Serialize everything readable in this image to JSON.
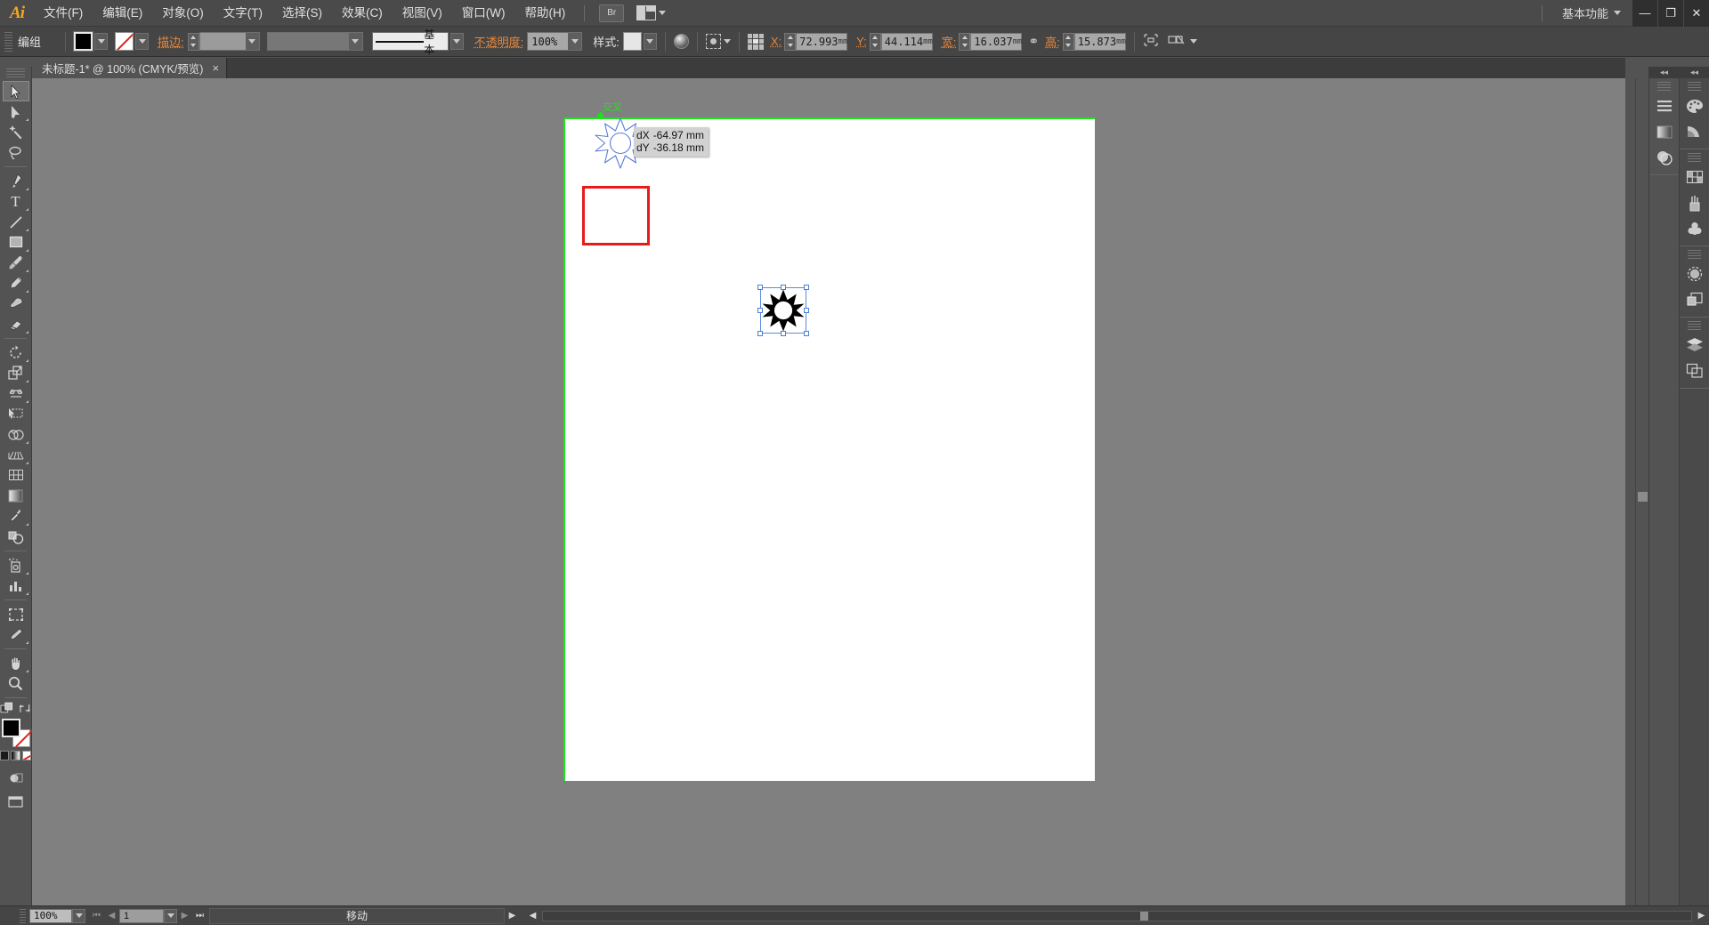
{
  "app": {
    "name": "Ai",
    "workspace": "基本功能",
    "window_buttons": [
      "—",
      "❐",
      "✕"
    ]
  },
  "menubar": {
    "items": [
      "文件(F)",
      "编辑(E)",
      "对象(O)",
      "文字(T)",
      "选择(S)",
      "效果(C)",
      "视图(V)",
      "窗口(W)",
      "帮助(H)"
    ],
    "bridge_label": "Br",
    "arrange_icon": "arrange-documents-icon"
  },
  "controlbar": {
    "object_label": "编组",
    "fill_label": "fill-swatch",
    "stroke_swatch_label": "stroke-swatch-none",
    "stroke_label": "描边:",
    "stroke_weight": "",
    "stroke_style": "",
    "stroke_profile": "基本",
    "opacity_label": "不透明度:",
    "opacity_value": "100%",
    "style_label": "样式:",
    "recolor_icon": "recolor-artwork-icon",
    "align_icon": "align-icon",
    "reference_point": "transform-reference-point",
    "x_label": "X:",
    "x_value": "72.993",
    "x_unit": "mm",
    "y_label": "Y:",
    "y_value": "44.114",
    "y_unit": "mm",
    "w_label": "宽:",
    "w_value": "16.037",
    "w_unit": "mm",
    "lock_icon": "constrain-proportions-icon",
    "h_label": "高:",
    "h_value": "15.873",
    "h_unit": "mm",
    "transform_icon": "transform-panel-icon",
    "isolate_icon": "isolate-selected-icon"
  },
  "tabs": [
    {
      "title": "未标题-1* @ 100% (CMYK/预览)",
      "close": "×",
      "active": true
    }
  ],
  "toolbar": {
    "tools": [
      {
        "name": "selection-tool",
        "selected": true,
        "flyout": false
      },
      {
        "name": "direct-selection-tool",
        "selected": false,
        "flyout": true
      },
      {
        "name": "magic-wand-tool",
        "selected": false,
        "flyout": false
      },
      {
        "name": "lasso-tool",
        "selected": false,
        "flyout": false
      },
      {
        "name": "pen-tool",
        "selected": false,
        "flyout": true
      },
      {
        "name": "type-tool",
        "selected": false,
        "flyout": true
      },
      {
        "name": "line-segment-tool",
        "selected": false,
        "flyout": true
      },
      {
        "name": "rectangle-tool",
        "selected": false,
        "flyout": true
      },
      {
        "name": "paintbrush-tool",
        "selected": false,
        "flyout": true
      },
      {
        "name": "pencil-tool",
        "selected": false,
        "flyout": true
      },
      {
        "name": "blob-brush-tool",
        "selected": false,
        "flyout": false
      },
      {
        "name": "eraser-tool",
        "selected": false,
        "flyout": true
      },
      {
        "name": "rotate-tool",
        "selected": false,
        "flyout": true
      },
      {
        "name": "scale-tool",
        "selected": false,
        "flyout": true
      },
      {
        "name": "width-tool",
        "selected": false,
        "flyout": true
      },
      {
        "name": "free-transform-tool",
        "selected": false,
        "flyout": false
      },
      {
        "name": "shape-builder-tool",
        "selected": false,
        "flyout": true
      },
      {
        "name": "perspective-grid-tool",
        "selected": false,
        "flyout": true
      },
      {
        "name": "mesh-tool",
        "selected": false,
        "flyout": false
      },
      {
        "name": "gradient-tool",
        "selected": false,
        "flyout": false
      },
      {
        "name": "eyedropper-tool",
        "selected": false,
        "flyout": true
      },
      {
        "name": "blend-tool",
        "selected": false,
        "flyout": false
      },
      {
        "name": "symbol-sprayer-tool",
        "selected": false,
        "flyout": true
      },
      {
        "name": "column-graph-tool",
        "selected": false,
        "flyout": true
      },
      {
        "name": "artboard-tool",
        "selected": false,
        "flyout": false
      },
      {
        "name": "slice-tool",
        "selected": false,
        "flyout": true
      },
      {
        "name": "hand-tool",
        "selected": false,
        "flyout": true
      },
      {
        "name": "zoom-tool",
        "selected": false,
        "flyout": false
      }
    ],
    "fill_color": "#000000",
    "stroke_color": "none",
    "swap_icon": "swap-fill-stroke-icon",
    "default_icon": "default-fill-stroke-icon",
    "gradient_icons": [
      "color-icon",
      "gradient-icon",
      "none-icon"
    ],
    "drawing_mode_icon": "draw-normal-icon",
    "screen_mode_icon": "change-screen-mode-icon"
  },
  "canvas": {
    "zoom": "100%",
    "artboard_bg": "#ffffff",
    "pasteboard_bg": "#808080",
    "smart_guide_label": "交叉",
    "smart_guide_color": "#19e519",
    "measurement": {
      "dx_label": "dX",
      "dx_value": "-64.97 mm",
      "dy_label": "dY",
      "dy_value": "-36.18 mm"
    },
    "dragged_object": "sun-shape-preview",
    "selected_object": "sun-shape-selected",
    "annotation_rect_color": "#e81b1b"
  },
  "right_dock": {
    "collapse_icon": "collapse-panels-icon",
    "groups_inner": [
      [
        "align-panel-icon",
        "gradient-panel-icon",
        "transparency-panel-icon"
      ]
    ],
    "groups_outer": [
      [
        "color-panel-icon",
        "color-guide-panel-icon"
      ],
      [
        "swatches-panel-icon",
        "brushes-panel-icon",
        "symbols-panel-icon"
      ],
      [
        "appearance-panel-icon",
        "graphic-styles-panel-icon"
      ],
      [
        "layers-panel-icon",
        "artboards-panel-icon"
      ]
    ]
  },
  "statusbar": {
    "zoom_value": "100%",
    "first_page_icon": "first-page-icon",
    "prev_page_icon": "prev-page-icon",
    "page_value": "1",
    "next_page_icon": "next-page-icon",
    "last_page_icon": "last-page-icon",
    "status_text": "移动",
    "status_menu_icon": "status-menu-icon",
    "scroll_left_icon": "scroll-left-icon",
    "scroll_right_icon": "scroll-right-icon"
  }
}
